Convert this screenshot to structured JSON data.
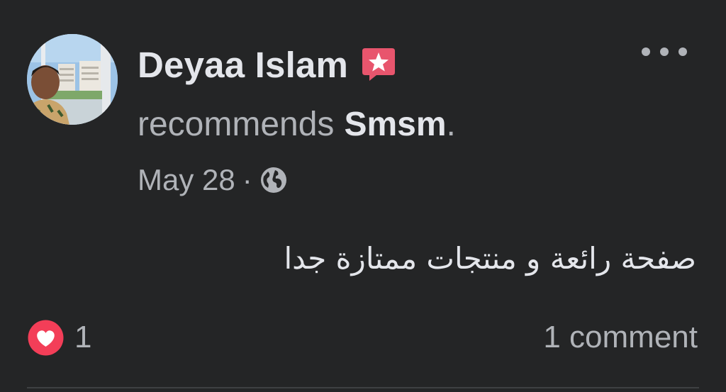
{
  "post": {
    "author": "Deyaa Islam",
    "badge_icon": "top-fan-star-badge-icon",
    "recommendation_verb": "recommends",
    "recommended_page": "Smsm",
    "recommendation_end": ".",
    "date": "May 28",
    "separator": "·",
    "audience_icon": "globe-icon",
    "body": "صفحة رائعة و منتجات ممتازة جدا",
    "reaction_icon": "love-reaction-icon",
    "reaction_count": "1",
    "comments_label": "1 comment"
  },
  "colors": {
    "background": "#242526",
    "primary_text": "#e4e6eb",
    "secondary_text": "#b0b3b8",
    "badge": "#e8556d",
    "love_reaction": "#f33e58",
    "divider": "#3e4042"
  }
}
